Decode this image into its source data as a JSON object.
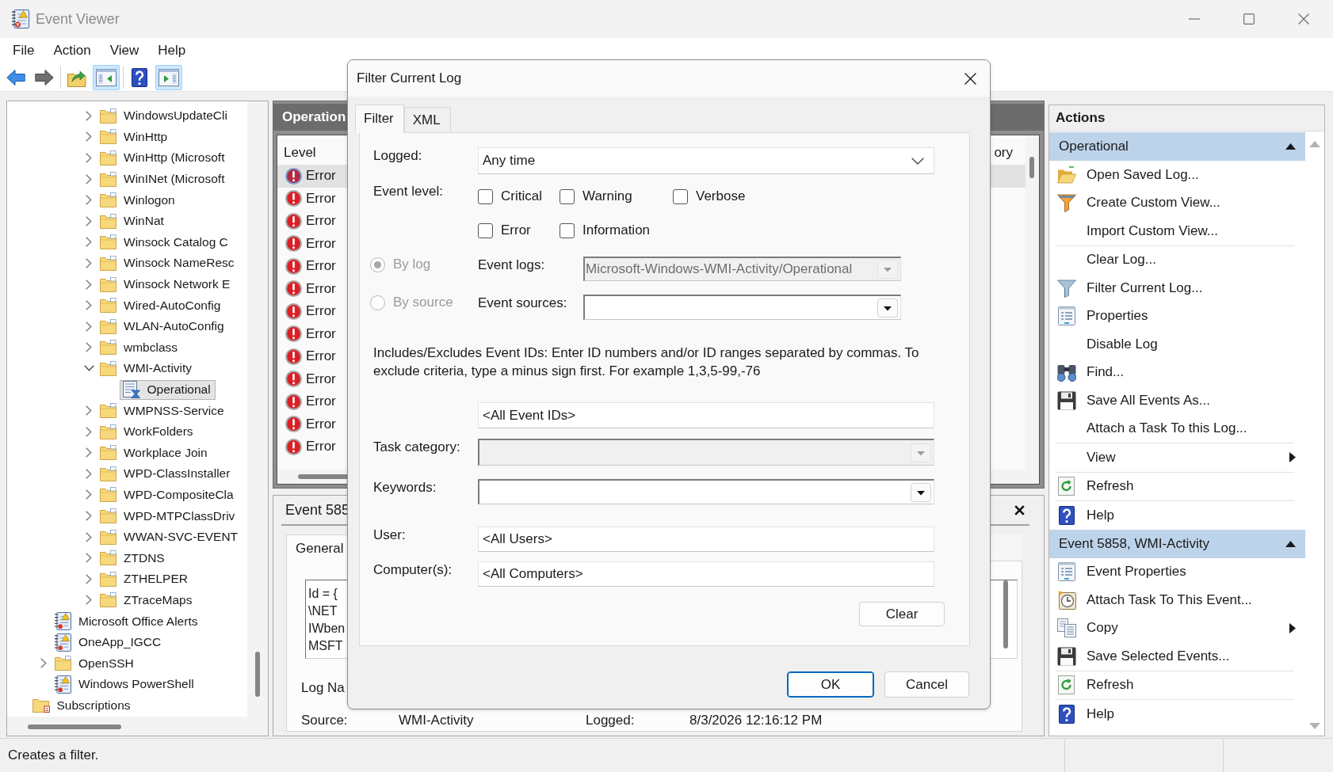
{
  "window": {
    "title": "Event Viewer"
  },
  "menu": [
    "File",
    "Action",
    "View",
    "Help"
  ],
  "toolbar": [
    [
      {
        "kind": "back",
        "disabled": false,
        "pressed": false
      },
      {
        "kind": "forward",
        "disabled": true,
        "pressed": false
      }
    ],
    [
      {
        "kind": "up",
        "disabled": false,
        "pressed": false
      },
      {
        "kind": "console-tree",
        "disabled": false,
        "pressed": true
      }
    ],
    [
      {
        "kind": "help",
        "disabled": false,
        "pressed": false
      },
      {
        "kind": "action-pane",
        "disabled": false,
        "pressed": true
      }
    ]
  ],
  "tree": {
    "items": [
      {
        "children": [
          {
            "children": [
              {
                "children": [
                  {
                    "label": "WindowsUpdateCli",
                    "kind": "folder",
                    "expanded": false,
                    "selected": false
                  },
                  {
                    "label": "WinHttp",
                    "kind": "folder",
                    "expanded": false,
                    "selected": false
                  },
                  {
                    "label": "WinHttp (Microsoft",
                    "kind": "folder",
                    "expanded": false,
                    "selected": false
                  },
                  {
                    "label": "WinINet (Microsoft",
                    "kind": "folder",
                    "expanded": false,
                    "selected": false
                  },
                  {
                    "label": "Winlogon",
                    "kind": "folder",
                    "expanded": false,
                    "selected": false
                  },
                  {
                    "label": "WinNat",
                    "kind": "folder",
                    "expanded": false,
                    "selected": false
                  },
                  {
                    "label": "Winsock Catalog C",
                    "kind": "folder",
                    "expanded": false,
                    "selected": false
                  },
                  {
                    "label": "Winsock NameResc",
                    "kind": "folder",
                    "expanded": false,
                    "selected": false
                  },
                  {
                    "label": "Winsock Network E",
                    "kind": "folder",
                    "expanded": false,
                    "selected": false
                  },
                  {
                    "label": "Wired-AutoConfig",
                    "kind": "folder",
                    "expanded": false,
                    "selected": false
                  },
                  {
                    "label": "WLAN-AutoConfig",
                    "kind": "folder",
                    "expanded": false,
                    "selected": false
                  },
                  {
                    "label": "wmbclass",
                    "kind": "folder",
                    "expanded": false,
                    "selected": false
                  },
                  {
                    "label": "WMI-Activity",
                    "kind": "folder",
                    "expanded": true,
                    "selected": false,
                    "children": [
                      {
                        "label": "Operational",
                        "kind": "channel",
                        "selected": true
                      }
                    ]
                  },
                  {
                    "label": "WMPNSS-Service",
                    "kind": "folder",
                    "expanded": false,
                    "selected": false
                  },
                  {
                    "label": "WorkFolders",
                    "kind": "folder",
                    "expanded": false,
                    "selected": false
                  },
                  {
                    "label": "Workplace Join",
                    "kind": "folder",
                    "expanded": false,
                    "selected": false
                  },
                  {
                    "label": "WPD-ClassInstaller",
                    "kind": "folder",
                    "expanded": false,
                    "selected": false
                  },
                  {
                    "label": "WPD-CompositeCla",
                    "kind": "folder",
                    "expanded": false,
                    "selected": false
                  },
                  {
                    "label": "WPD-MTPClassDriv",
                    "kind": "folder",
                    "expanded": false,
                    "selected": false
                  },
                  {
                    "label": "WWAN-SVC-EVENT",
                    "kind": "folder",
                    "expanded": false,
                    "selected": false
                  },
                  {
                    "label": "ZTDNS",
                    "kind": "folder",
                    "expanded": false,
                    "selected": false
                  },
                  {
                    "label": "ZTHELPER",
                    "kind": "folder",
                    "expanded": false,
                    "selected": false
                  },
                  {
                    "label": "ZTraceMaps",
                    "kind": "folder",
                    "expanded": false,
                    "selected": false
                  }
                ]
              }
            ]
          },
          {
            "label": "Microsoft Office Alerts",
            "kind": "log",
            "selected": false
          },
          {
            "label": "OneApp_IGCC",
            "kind": "log",
            "selected": false
          },
          {
            "label": "OpenSSH",
            "kind": "folder",
            "expanded": false,
            "selected": false
          },
          {
            "label": "Windows PowerShell",
            "kind": "log",
            "selected": false
          }
        ]
      },
      {
        "label": "Subscriptions",
        "kind": "subscriptions",
        "selected": false
      }
    ]
  },
  "event_list": {
    "title": "Operation",
    "columns": [
      "Level",
      "ory"
    ],
    "rows": [
      {
        "level": "Error",
        "selected": true
      },
      {
        "level": "Error",
        "selected": false
      },
      {
        "level": "Error",
        "selected": false
      },
      {
        "level": "Error",
        "selected": false
      },
      {
        "level": "Error",
        "selected": false
      },
      {
        "level": "Error",
        "selected": false
      },
      {
        "level": "Error",
        "selected": false
      },
      {
        "level": "Error",
        "selected": false
      },
      {
        "level": "Error",
        "selected": false
      },
      {
        "level": "Error",
        "selected": false
      },
      {
        "level": "Error",
        "selected": false
      },
      {
        "level": "Error",
        "selected": false
      },
      {
        "level": "Error",
        "selected": false
      }
    ]
  },
  "event_detail": {
    "title": "Event 585",
    "tabs": [
      {
        "label": "General",
        "selected": true
      }
    ],
    "description": [
      "Id = {",
      "\\NET",
      "IWben",
      "MSFT"
    ],
    "fields": [
      [
        {
          "label": "Log Na"
        }
      ],
      [
        {
          "label": "Source:",
          "value": "WMI-Activity"
        },
        {
          "label": "Logged:",
          "value": "8/3/2026 12:16:12 PM"
        }
      ]
    ]
  },
  "dialog": {
    "title": "Filter Current Log",
    "tabs": [
      {
        "label": "Filter",
        "selected": true
      },
      {
        "label": "XML",
        "selected": false
      }
    ],
    "logged": {
      "label": "Logged:",
      "value": "Any time"
    },
    "event_level": {
      "label": "Event level:",
      "options": [
        {
          "label": "Critical",
          "checked": false
        },
        {
          "label": "Warning",
          "checked": false
        },
        {
          "label": "Verbose",
          "checked": false
        },
        {
          "label": "Error",
          "checked": false
        },
        {
          "label": "Information",
          "checked": false
        }
      ]
    },
    "sources": [
      {
        "label": "By log",
        "selected": true,
        "disabled": true,
        "field_label": "Event logs:",
        "value": "Microsoft-Windows-WMI-Activity/Operational",
        "field_disabled": true
      },
      {
        "label": "By source",
        "selected": false,
        "disabled": true,
        "field_label": "Event sources:",
        "field_disabled": false
      }
    ],
    "event_ids": {
      "help": "Includes/Excludes Event IDs: Enter ID numbers and/or ID ranges separated by commas. To exclude criteria, type a minus sign first. For example 1,3,5-99,-76",
      "value": "<All Event IDs>"
    },
    "task_category": {
      "label": "Task category:",
      "disabled": true
    },
    "keywords": {
      "label": "Keywords:",
      "disabled": false
    },
    "user": {
      "label": "User:",
      "value": "<All Users>"
    },
    "computers": {
      "label": "Computer(s):",
      "value": "<All Computers>"
    },
    "clear_button": {
      "label": "Clear"
    },
    "buttons": [
      {
        "label": "OK",
        "focused": true
      },
      {
        "label": "Cancel",
        "focused": false
      }
    ]
  },
  "actions": {
    "title": "Actions",
    "sections": [
      {
        "title": "Operational",
        "expanded": true,
        "groups": [
          [
            {
              "label": "Open Saved Log...",
              "kind": "open-folder",
              "submenu": false
            },
            {
              "label": "Create Custom View...",
              "kind": "custom-filter",
              "submenu": false
            },
            {
              "label": "Import Custom View...",
              "kind": "none",
              "submenu": false
            }
          ],
          [
            {
              "label": "Clear Log...",
              "kind": "none",
              "submenu": false
            },
            {
              "label": "Filter Current Log...",
              "kind": "filter",
              "submenu": false
            },
            {
              "label": "Properties",
              "kind": "properties",
              "submenu": false
            },
            {
              "label": "Disable Log",
              "kind": "none",
              "submenu": false
            },
            {
              "label": "Find...",
              "kind": "find",
              "submenu": false
            },
            {
              "label": "Save All Events As...",
              "kind": "save",
              "submenu": false
            },
            {
              "label": "Attach a Task To this Log...",
              "kind": "none",
              "submenu": false
            }
          ],
          [
            {
              "label": "View",
              "kind": "none",
              "submenu": true
            }
          ],
          [
            {
              "label": "Refresh",
              "kind": "refresh",
              "submenu": false
            }
          ],
          [
            {
              "label": "Help",
              "kind": "help",
              "submenu": false
            }
          ]
        ]
      },
      {
        "title": "Event 5858, WMI-Activity",
        "expanded": true,
        "groups": [
          [
            {
              "label": "Event Properties",
              "kind": "properties",
              "submenu": false
            },
            {
              "label": "Attach Task To This Event...",
              "kind": "task",
              "submenu": false
            },
            {
              "label": "Copy",
              "kind": "copy",
              "submenu": true
            },
            {
              "label": "Save Selected Events...",
              "kind": "save",
              "submenu": false
            }
          ],
          [
            {
              "label": "Refresh",
              "kind": "refresh",
              "submenu": false
            }
          ],
          [
            {
              "label": "Help",
              "kind": "help",
              "submenu": false
            }
          ]
        ]
      }
    ]
  },
  "status_bar": {
    "text": "Creates a filter."
  }
}
